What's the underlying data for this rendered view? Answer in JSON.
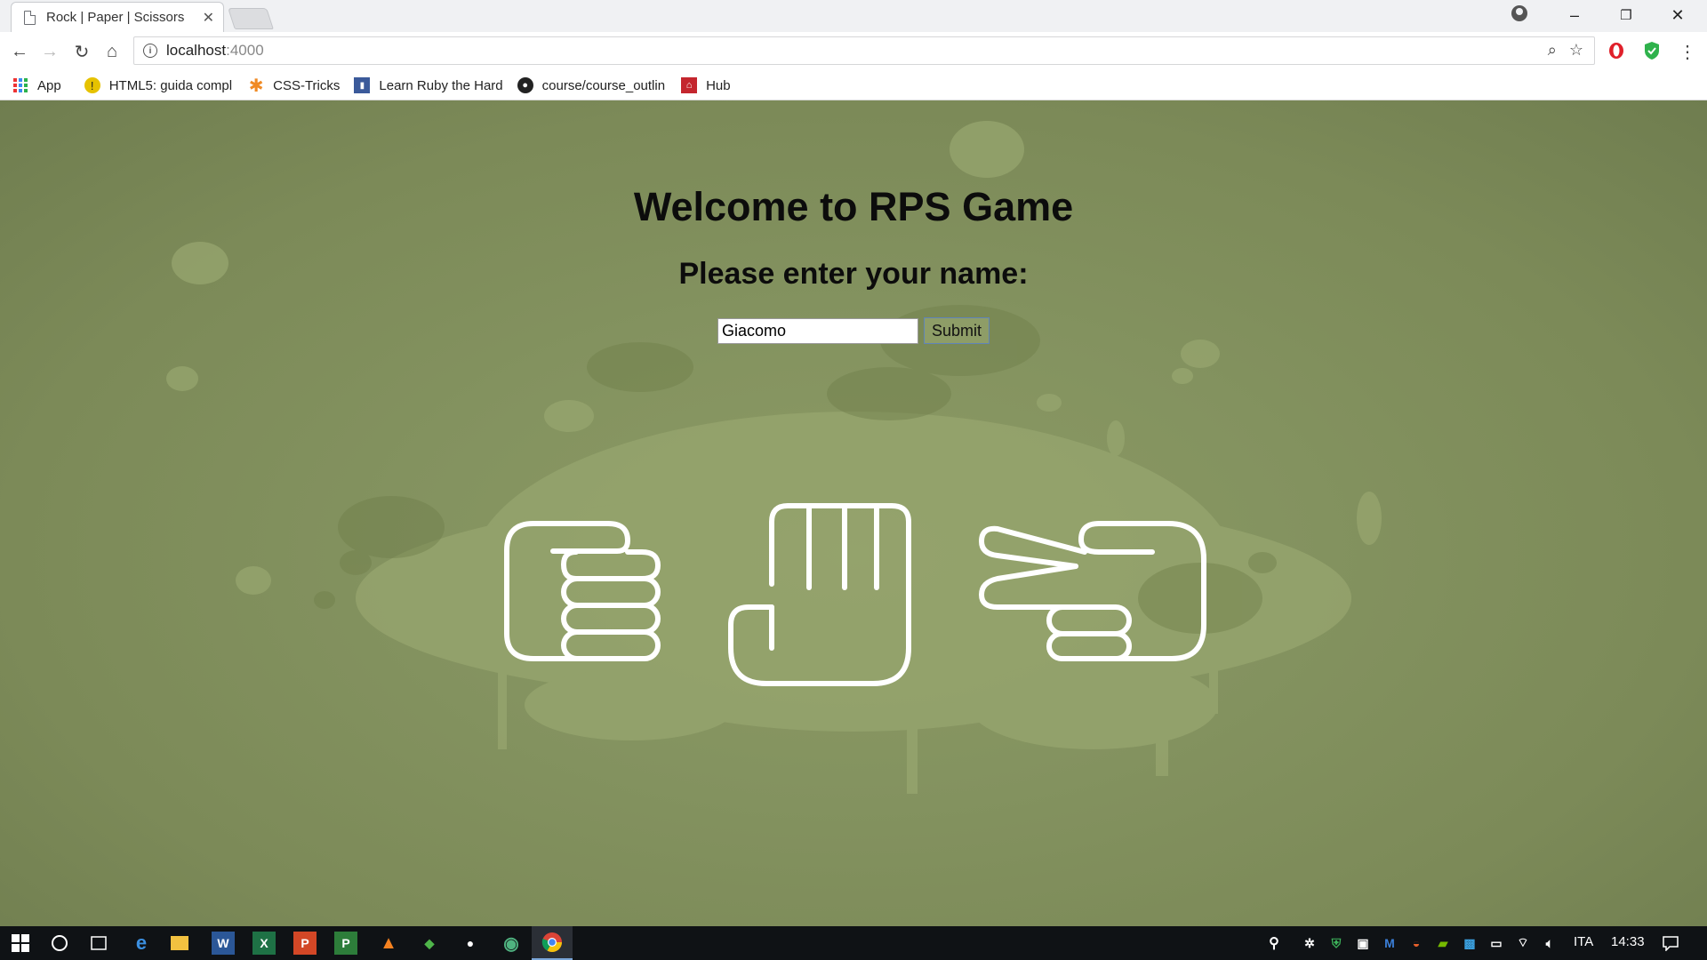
{
  "browser": {
    "tab_title": "Rock | Paper | Scissors",
    "tab_close": "✕",
    "window_controls": {
      "minimize": "–",
      "restore": "❐",
      "close": "✕"
    },
    "url_host": "localhost",
    "url_port": ":4000",
    "bookmarks": [
      {
        "label": "App",
        "icon": "apps-icon"
      },
      {
        "label": "HTML5: guida compl",
        "icon": "html5-guide-icon"
      },
      {
        "label": "CSS-Tricks",
        "icon": "css-tricks-icon"
      },
      {
        "label": "Learn Ruby the Hard",
        "icon": "ruby-book-icon"
      },
      {
        "label": "course/course_outlin",
        "icon": "github-icon"
      },
      {
        "label": "Hub",
        "icon": "hub-icon"
      }
    ]
  },
  "page": {
    "title": "Welcome to RPS Game",
    "prompt": "Please enter your name:",
    "name_value": "Giacomo",
    "submit_label": "Submit",
    "choices": [
      "rock",
      "paper",
      "scissors"
    ],
    "background_color": "#849360"
  },
  "taskbar": {
    "language": "ITA",
    "time": "14:33"
  }
}
